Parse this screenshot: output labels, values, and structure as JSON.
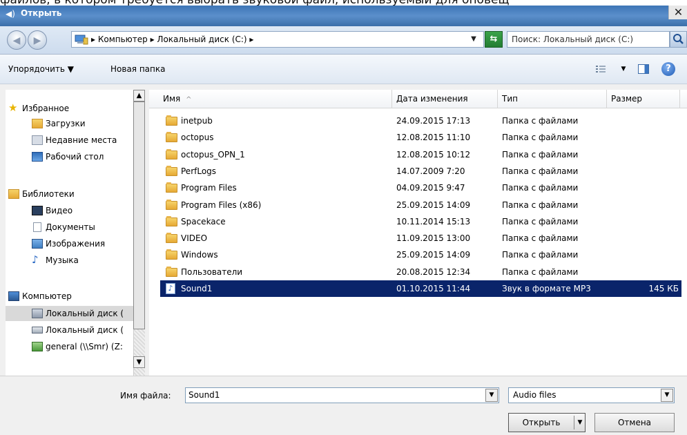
{
  "caption": "файлов, в котором требуется выбрать звуковой файл, используемый для оповещ",
  "window": {
    "title": "Открыть",
    "close": "✕"
  },
  "nav": {
    "back": "◀",
    "forward": "▶",
    "address": "▸ Компьютер ▸ Локальный диск (C:) ▸",
    "address_drop": "▼",
    "search_placeholder": "Поиск: Локальный диск (C:)"
  },
  "toolbar": {
    "organize": "Упорядочить ▼",
    "new_folder": "Новая папка",
    "views_drop": "▼",
    "help": "?"
  },
  "sidebar": {
    "favorites": "Избранное",
    "downloads": "Загрузки",
    "recent": "Недавние места",
    "desktop": "Рабочий стол",
    "libraries": "Библиотеки",
    "video": "Видео",
    "documents": "Документы",
    "images": "Изображения",
    "music": "Музыка",
    "computer": "Компьютер",
    "disk_c": "Локальный диск (",
    "disk_d": "Локальный диск (",
    "net": "general (\\\\Smr) (Z:"
  },
  "columns": {
    "name": "Имя",
    "sort": "^",
    "date": "Дата изменения",
    "type": "Тип",
    "size": "Размер"
  },
  "files": [
    {
      "name": "inetpub",
      "date": "24.09.2015 17:13",
      "type": "Папка с файлами",
      "size": ""
    },
    {
      "name": "octopus",
      "date": "12.08.2015 11:10",
      "type": "Папка с файлами",
      "size": ""
    },
    {
      "name": "octopus_OPN_1",
      "date": "12.08.2015 10:12",
      "type": "Папка с файлами",
      "size": ""
    },
    {
      "name": "PerfLogs",
      "date": "14.07.2009 7:20",
      "type": "Папка с файлами",
      "size": ""
    },
    {
      "name": "Program Files",
      "date": "04.09.2015 9:47",
      "type": "Папка с файлами",
      "size": ""
    },
    {
      "name": "Program Files (x86)",
      "date": "25.09.2015 14:09",
      "type": "Папка с файлами",
      "size": ""
    },
    {
      "name": "Spacekace",
      "date": "10.11.2014 15:13",
      "type": "Папка с файлами",
      "size": ""
    },
    {
      "name": "VIDEO",
      "date": "11.09.2015 13:00",
      "type": "Папка с файлами",
      "size": ""
    },
    {
      "name": "Windows",
      "date": "25.09.2015 14:09",
      "type": "Папка с файлами",
      "size": ""
    },
    {
      "name": "Пользователи",
      "date": "20.08.2015 12:34",
      "type": "Папка с файлами",
      "size": ""
    },
    {
      "name": "Sound1",
      "date": "01.10.2015 11:44",
      "type": "Звук в формате MP3",
      "size": "145 КБ"
    }
  ],
  "bottom": {
    "filename_label": "Имя файла:",
    "filename": "Sound1",
    "filetype": "Audio files",
    "drop": "▼",
    "open": "Открыть",
    "cancel": "Отмена"
  }
}
